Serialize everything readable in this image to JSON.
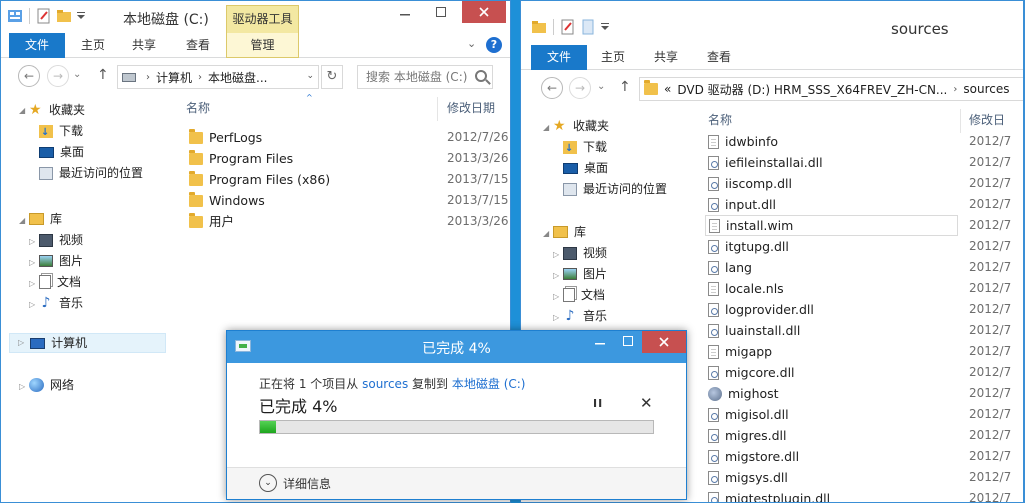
{
  "left": {
    "title": "本地磁盘 (C:)",
    "context_tab": "驱动器工具",
    "ribbon_tabs": [
      "文件",
      "主页",
      "共享",
      "查看",
      "管理"
    ],
    "help_icon": "?",
    "address": {
      "computer": "计算机",
      "drive": "本地磁盘..."
    },
    "search_placeholder": "搜索 本地磁盘 (C:)",
    "nav": {
      "favorites": "收藏夹",
      "downloads": "下载",
      "desktop": "桌面",
      "recent": "最近访问的位置",
      "libraries": "库",
      "videos": "视频",
      "pictures": "图片",
      "documents": "文档",
      "music": "音乐",
      "computer": "计算机",
      "network": "网络"
    },
    "columns": {
      "name": "名称",
      "date": "修改日期"
    },
    "files": [
      {
        "name": "PerfLogs",
        "date": "2012/7/26"
      },
      {
        "name": "Program Files",
        "date": "2013/3/26"
      },
      {
        "name": "Program Files (x86)",
        "date": "2013/7/15"
      },
      {
        "name": "Windows",
        "date": "2013/7/15"
      },
      {
        "name": "用户",
        "date": "2013/3/26"
      }
    ]
  },
  "right": {
    "title": "sources",
    "ribbon_tabs": [
      "文件",
      "主页",
      "共享",
      "查看"
    ],
    "address": {
      "prefix": "«",
      "drive": "DVD 驱动器 (D:) HRM_SSS_X64FREV_ZH-CN...",
      "folder": "sources"
    },
    "nav": {
      "favorites": "收藏夹",
      "downloads": "下载",
      "desktop": "桌面",
      "recent": "最近访问的位置",
      "libraries": "库",
      "videos": "视频",
      "pictures": "图片",
      "documents": "文档",
      "music": "音乐"
    },
    "columns": {
      "name": "名称",
      "date": "修改日"
    },
    "files": [
      {
        "name": "idwbinfo",
        "date": "2012/7",
        "icon": "doc-blank"
      },
      {
        "name": "iefileinstallai.dll",
        "date": "2012/7",
        "icon": "doc-gear"
      },
      {
        "name": "iiscomp.dll",
        "date": "2012/7",
        "icon": "doc-gear"
      },
      {
        "name": "input.dll",
        "date": "2012/7",
        "icon": "doc-gear"
      },
      {
        "name": "install.wim",
        "date": "2012/7",
        "icon": "doc-blank"
      },
      {
        "name": "itgtupg.dll",
        "date": "2012/7",
        "icon": "doc-gear"
      },
      {
        "name": "lang",
        "date": "2012/7",
        "icon": "doc-gear"
      },
      {
        "name": "locale.nls",
        "date": "2012/7",
        "icon": "doc-blank"
      },
      {
        "name": "logprovider.dll",
        "date": "2012/7",
        "icon": "doc-gear"
      },
      {
        "name": "luainstall.dll",
        "date": "2012/7",
        "icon": "doc-gear"
      },
      {
        "name": "migapp",
        "date": "2012/7",
        "icon": "doc-blank"
      },
      {
        "name": "migcore.dll",
        "date": "2012/7",
        "icon": "doc-gear"
      },
      {
        "name": "mighost",
        "date": "2012/7",
        "icon": "app"
      },
      {
        "name": "migisol.dll",
        "date": "2012/7",
        "icon": "doc-gear"
      },
      {
        "name": "migres.dll",
        "date": "2012/7",
        "icon": "doc-gear"
      },
      {
        "name": "migstore.dll",
        "date": "2012/7",
        "icon": "doc-gear"
      },
      {
        "name": "migsys.dll",
        "date": "2012/7",
        "icon": "doc-gear"
      },
      {
        "name": "migtestplugin.dll",
        "date": "2012/7",
        "icon": "doc-gear"
      }
    ]
  },
  "dialog": {
    "title": "已完成 4%",
    "desc_prefix": "正在将 1 个项目从",
    "source": "sources",
    "desc_mid": "复制到",
    "dest": "本地磁盘 (C:)",
    "percent_label": "已完成 4%",
    "progress": 0.04,
    "more_details": "详细信息",
    "pause_symbol": "II",
    "cancel_symbol": "✕"
  },
  "colors": {
    "accent": "#1979ca",
    "dialog_title": "#3c98df",
    "close_button": "#c75050",
    "progress_fill": "#1ea51e"
  }
}
